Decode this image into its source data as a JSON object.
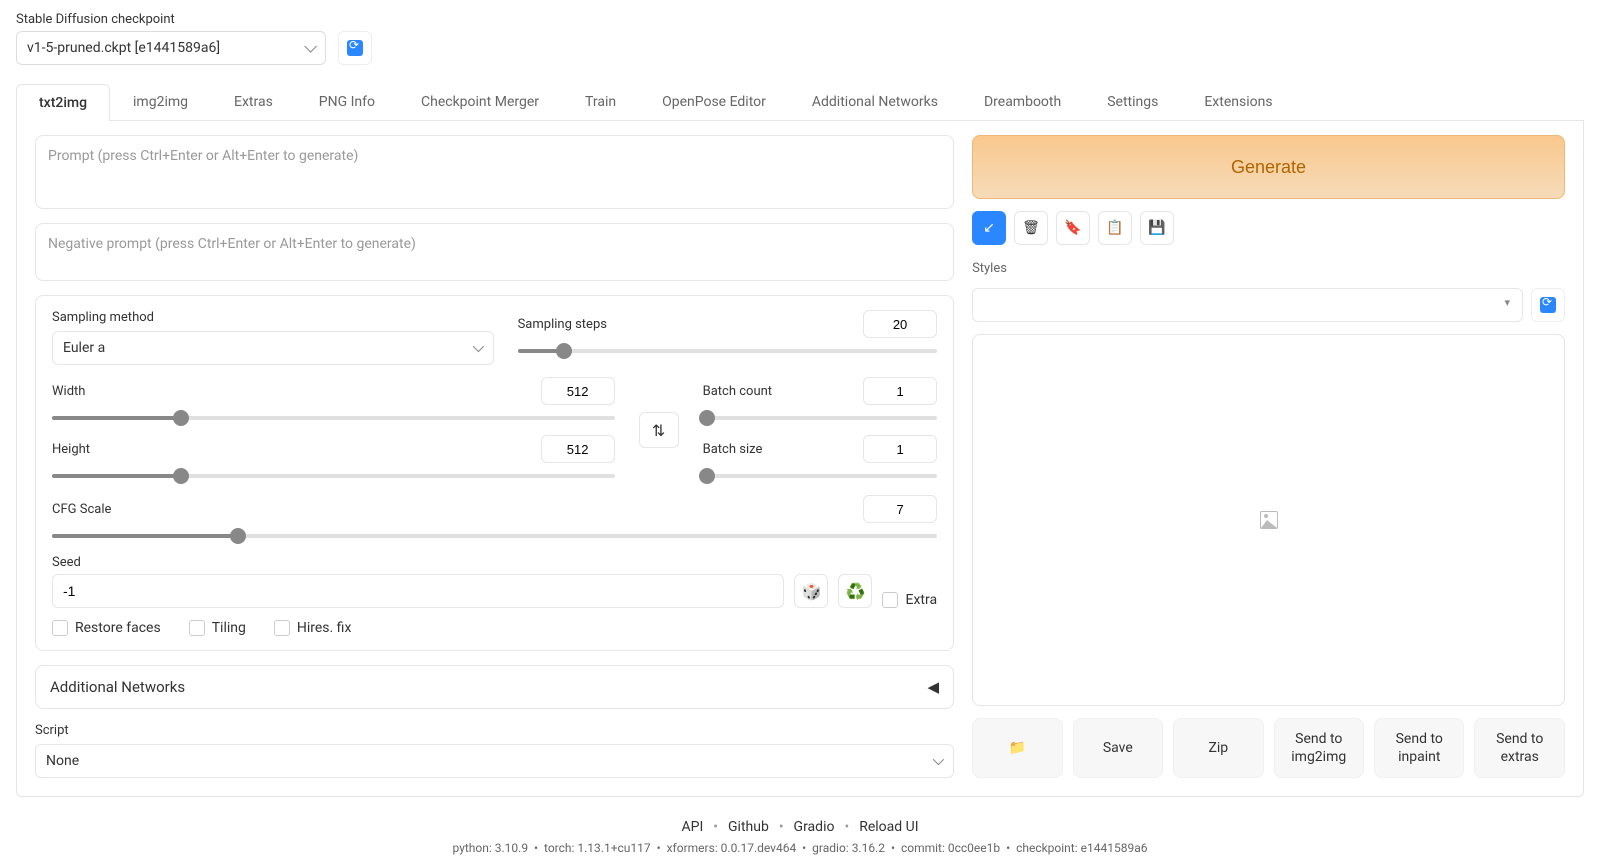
{
  "header": {
    "checkpoint_label": "Stable Diffusion checkpoint",
    "checkpoint_value": "v1-5-pruned.ckpt [e1441589a6]"
  },
  "tabs": [
    "txt2img",
    "img2img",
    "Extras",
    "PNG Info",
    "Checkpoint Merger",
    "Train",
    "OpenPose Editor",
    "Additional Networks",
    "Dreambooth",
    "Settings",
    "Extensions"
  ],
  "active_tab": 0,
  "prompt": {
    "placeholder": "Prompt (press Ctrl+Enter or Alt+Enter to generate)",
    "value": ""
  },
  "negative_prompt": {
    "placeholder": "Negative prompt (press Ctrl+Enter or Alt+Enter to generate)",
    "value": ""
  },
  "generate_label": "Generate",
  "action_icons": {
    "arrow": "↙",
    "trash": "🗑",
    "bookmark": "🔖",
    "clipboard": "📋",
    "save": "💾"
  },
  "styles_label": "Styles",
  "controls": {
    "sampling_method": {
      "label": "Sampling method",
      "value": "Euler a"
    },
    "sampling_steps": {
      "label": "Sampling steps",
      "value": "20",
      "min": 1,
      "max": 150,
      "pct": 11
    },
    "width": {
      "label": "Width",
      "value": "512",
      "min": 64,
      "max": 2048,
      "pct": 23
    },
    "height": {
      "label": "Height",
      "value": "512",
      "min": 64,
      "max": 2048,
      "pct": 23
    },
    "batch_count": {
      "label": "Batch count",
      "value": "1",
      "min": 1,
      "max": 100,
      "pct": 2
    },
    "batch_size": {
      "label": "Batch size",
      "value": "1",
      "min": 1,
      "max": 8,
      "pct": 2
    },
    "cfg": {
      "label": "CFG Scale",
      "value": "7",
      "min": 1,
      "max": 30,
      "pct": 21
    },
    "seed": {
      "label": "Seed",
      "value": "-1"
    },
    "extra_label": "Extra",
    "restore_faces": "Restore faces",
    "tiling": "Tiling",
    "hires_fix": "Hires. fix",
    "additional_networks": "Additional Networks",
    "script_label": "Script",
    "script_value": "None"
  },
  "output_actions": {
    "folder": "📁",
    "save": "Save",
    "zip": "Zip",
    "send_img2img": "Send to img2img",
    "send_inpaint": "Send to inpaint",
    "send_extras": "Send to extras"
  },
  "footer": {
    "links": [
      "API",
      "Github",
      "Gradio",
      "Reload UI"
    ],
    "meta_parts": [
      "python: 3.10.9",
      "torch: 1.13.1+cu117",
      "xformers: 0.0.17.dev464",
      "gradio: 3.16.2",
      "commit: 0cc0ee1b",
      "checkpoint: e1441589a6"
    ]
  }
}
